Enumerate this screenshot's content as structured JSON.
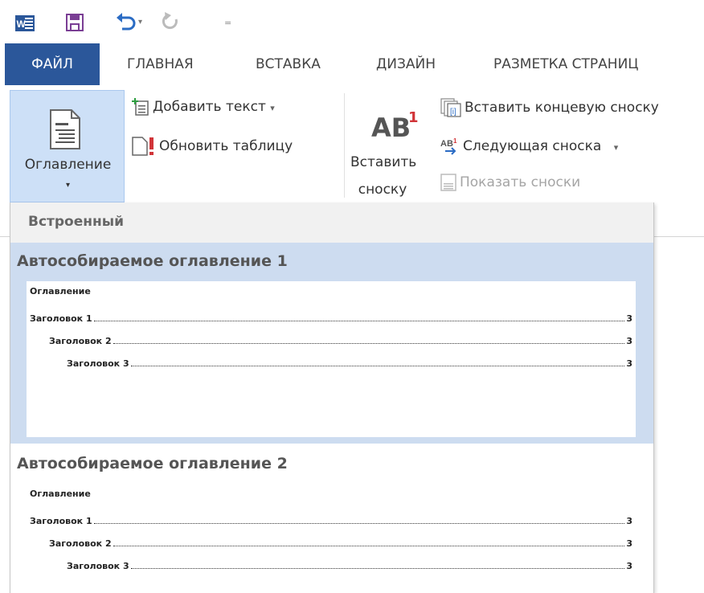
{
  "qat": {
    "app_icon": "word-icon",
    "app_letter": "W",
    "save_icon": "save-icon",
    "undo_icon": "undo-icon",
    "undo_dropdown": "▾",
    "redo_icon": "redo-icon",
    "customize": "="
  },
  "tabs": [
    {
      "label": "ФАЙЛ"
    },
    {
      "label": "ГЛАВНАЯ"
    },
    {
      "label": "ВСТАВКА"
    },
    {
      "label": "ДИЗАЙН"
    },
    {
      "label": "РАЗМЕТКА СТРАНИЦ"
    }
  ],
  "ribbon": {
    "toc": {
      "label": "Оглавление",
      "arrow": "▾",
      "icon": "table-of-contents-icon"
    },
    "add_text": {
      "label": "Добавить текст",
      "arrow": "▾",
      "icon": "add-text-icon"
    },
    "update_table": {
      "label": "Обновить таблицу",
      "icon": "update-table-icon"
    },
    "insert_footnote": {
      "ab": "AB",
      "sup": "1",
      "line1": "Вставить",
      "line2": "сноску",
      "icon": "insert-footnote-icon"
    },
    "insert_endnote": {
      "label": "Вставить концевую сноску",
      "icon": "insert-endnote-icon"
    },
    "next_footnote": {
      "label": "Следующая сноска",
      "arrow": "▾",
      "icon": "next-footnote-icon"
    },
    "show_notes": {
      "label": "Показать сноски",
      "icon": "show-notes-icon"
    }
  },
  "gallery": {
    "header": "Встроенный",
    "items": [
      {
        "title": "Автособираемое оглавление 1",
        "preview_title": "Оглавление",
        "entries": [
          {
            "text": "Заголовок 1",
            "page": "3"
          },
          {
            "text": "Заголовок 2",
            "page": "3"
          },
          {
            "text": "Заголовок 3",
            "page": "3"
          }
        ]
      },
      {
        "title": "Автособираемое оглавление 2",
        "preview_title": "Оглавление",
        "entries": [
          {
            "text": "Заголовок 1",
            "page": "3"
          },
          {
            "text": "Заголовок 2",
            "page": "3"
          },
          {
            "text": "Заголовок 3",
            "page": "3"
          }
        ]
      }
    ]
  },
  "colors": {
    "file_tab": "#2b579a",
    "hover": "#cddcf0",
    "accent_red": "#d13438"
  }
}
